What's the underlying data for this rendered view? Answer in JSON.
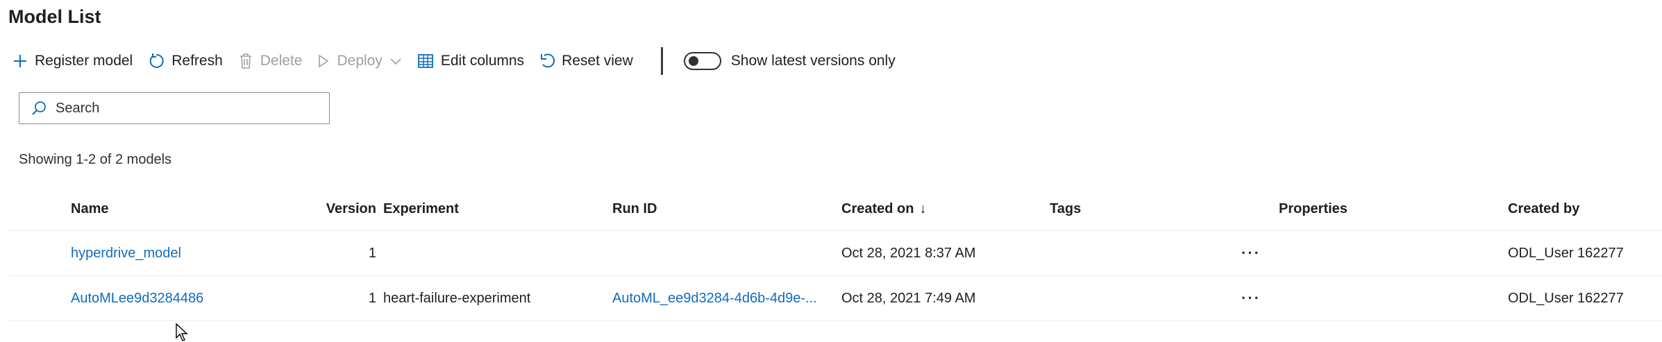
{
  "page": {
    "title": "Model List"
  },
  "toolbar": {
    "register_label": "Register model",
    "refresh_label": "Refresh",
    "delete_label": "Delete",
    "deploy_label": "Deploy",
    "edit_columns_label": "Edit columns",
    "reset_view_label": "Reset view",
    "toggle_label": "Show latest versions only",
    "toggle_on": false
  },
  "search": {
    "placeholder": "Search",
    "value": ""
  },
  "summary": {
    "count_text": "Showing 1-2 of 2 models"
  },
  "table": {
    "columns": {
      "name": "Name",
      "version": "Version",
      "experiment": "Experiment",
      "run_id": "Run ID",
      "created_on": "Created on",
      "sort_indicator": "↓",
      "tags": "Tags",
      "properties": "Properties",
      "created_by": "Created by"
    },
    "rows": [
      {
        "name": "hyperdrive_model",
        "version": "1",
        "experiment": "",
        "run_id": "",
        "created_on": "Oct 28, 2021 8:37 AM",
        "tags": "",
        "more": "···",
        "properties": "",
        "created_by": "ODL_User 162277"
      },
      {
        "name": "AutoMLee9d3284486",
        "version": "1",
        "experiment": "heart-failure-experiment",
        "run_id": "AutoML_ee9d3284-4d6b-4d9e-...",
        "created_on": "Oct 28, 2021 7:49 AM",
        "tags": "",
        "more": "···",
        "properties": "",
        "created_by": "ODL_User 162277"
      }
    ]
  },
  "colors": {
    "accent": "#0f6cbd",
    "disabled": "#a19f9d",
    "text": "#201f1e",
    "divider": "#edebe9"
  }
}
